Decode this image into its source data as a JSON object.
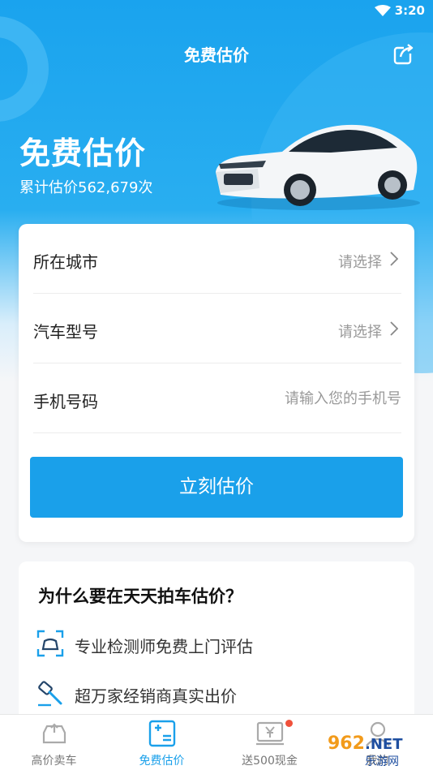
{
  "status_bar": {
    "time": "3:20"
  },
  "nav": {
    "title": "免费估价",
    "share_icon": "share-icon"
  },
  "hero": {
    "title": "免费估价",
    "count_text": "累计估价562,679次"
  },
  "form": {
    "rows": [
      {
        "label": "所在城市",
        "value": "请选择"
      },
      {
        "label": "汽车型号",
        "value": "请选择"
      },
      {
        "label": "手机号码",
        "placeholder": "请输入您的手机号"
      }
    ],
    "submit_label": "立刻估价"
  },
  "why": {
    "title": "为什么要在天天拍车估价？",
    "items": [
      {
        "text": "专业检测师免费上门评估",
        "icon": "inspection-icon"
      },
      {
        "text": "超万家经销商真实出价",
        "icon": "auction-hammer-icon"
      }
    ]
  },
  "tabs": [
    {
      "label": "高价卖车",
      "icon": "car-sell-icon"
    },
    {
      "label": "免费估价",
      "icon": "calculator-icon"
    },
    {
      "label": "送500现金",
      "icon": "cash-icon"
    },
    {
      "label": "我的",
      "icon": "profile-icon"
    }
  ],
  "colors": {
    "primary": "#1aa0ea",
    "badge": "#f0513b"
  },
  "watermark": {
    "text_main": "962.NET",
    "text_sub": "乐游网"
  }
}
